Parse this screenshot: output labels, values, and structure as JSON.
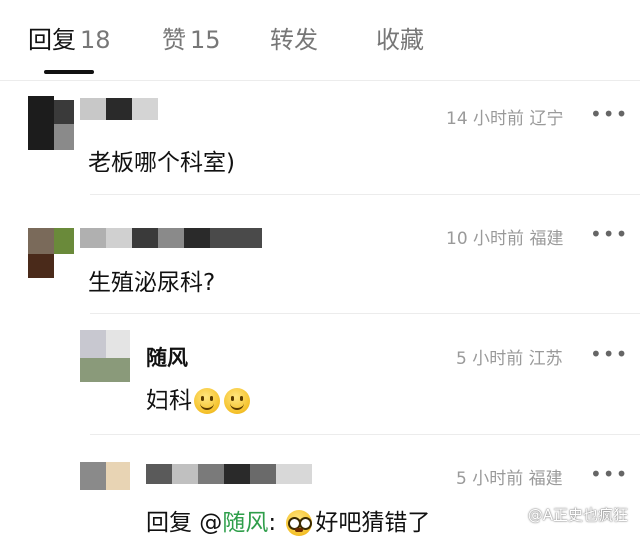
{
  "tabs": {
    "replies": {
      "label": "回复",
      "count": "18"
    },
    "likes": {
      "label": "赞",
      "count": "15"
    },
    "forwards": {
      "label": "转发"
    },
    "favorites": {
      "label": "收藏"
    }
  },
  "comments": [
    {
      "time": "14 小时前",
      "location": "辽宁",
      "text": "老板哪个科室)"
    },
    {
      "time": "10 小时前",
      "location": "福建",
      "text": "生殖泌尿科?"
    },
    {
      "username": "随风",
      "time": "5 小时前",
      "location": "江苏",
      "text": "妇科"
    },
    {
      "time": "5 小时前",
      "location": "福建",
      "reply_prefix": "回复 @",
      "reply_to": "随风",
      "reply_colon": ":",
      "text": "好吧猜错了"
    }
  ],
  "more_label": "•••",
  "watermark": "@A正史也疯狂",
  "colors": {
    "accent_green": "#2e9e4a",
    "meta_gray": "#9a9a9a"
  }
}
